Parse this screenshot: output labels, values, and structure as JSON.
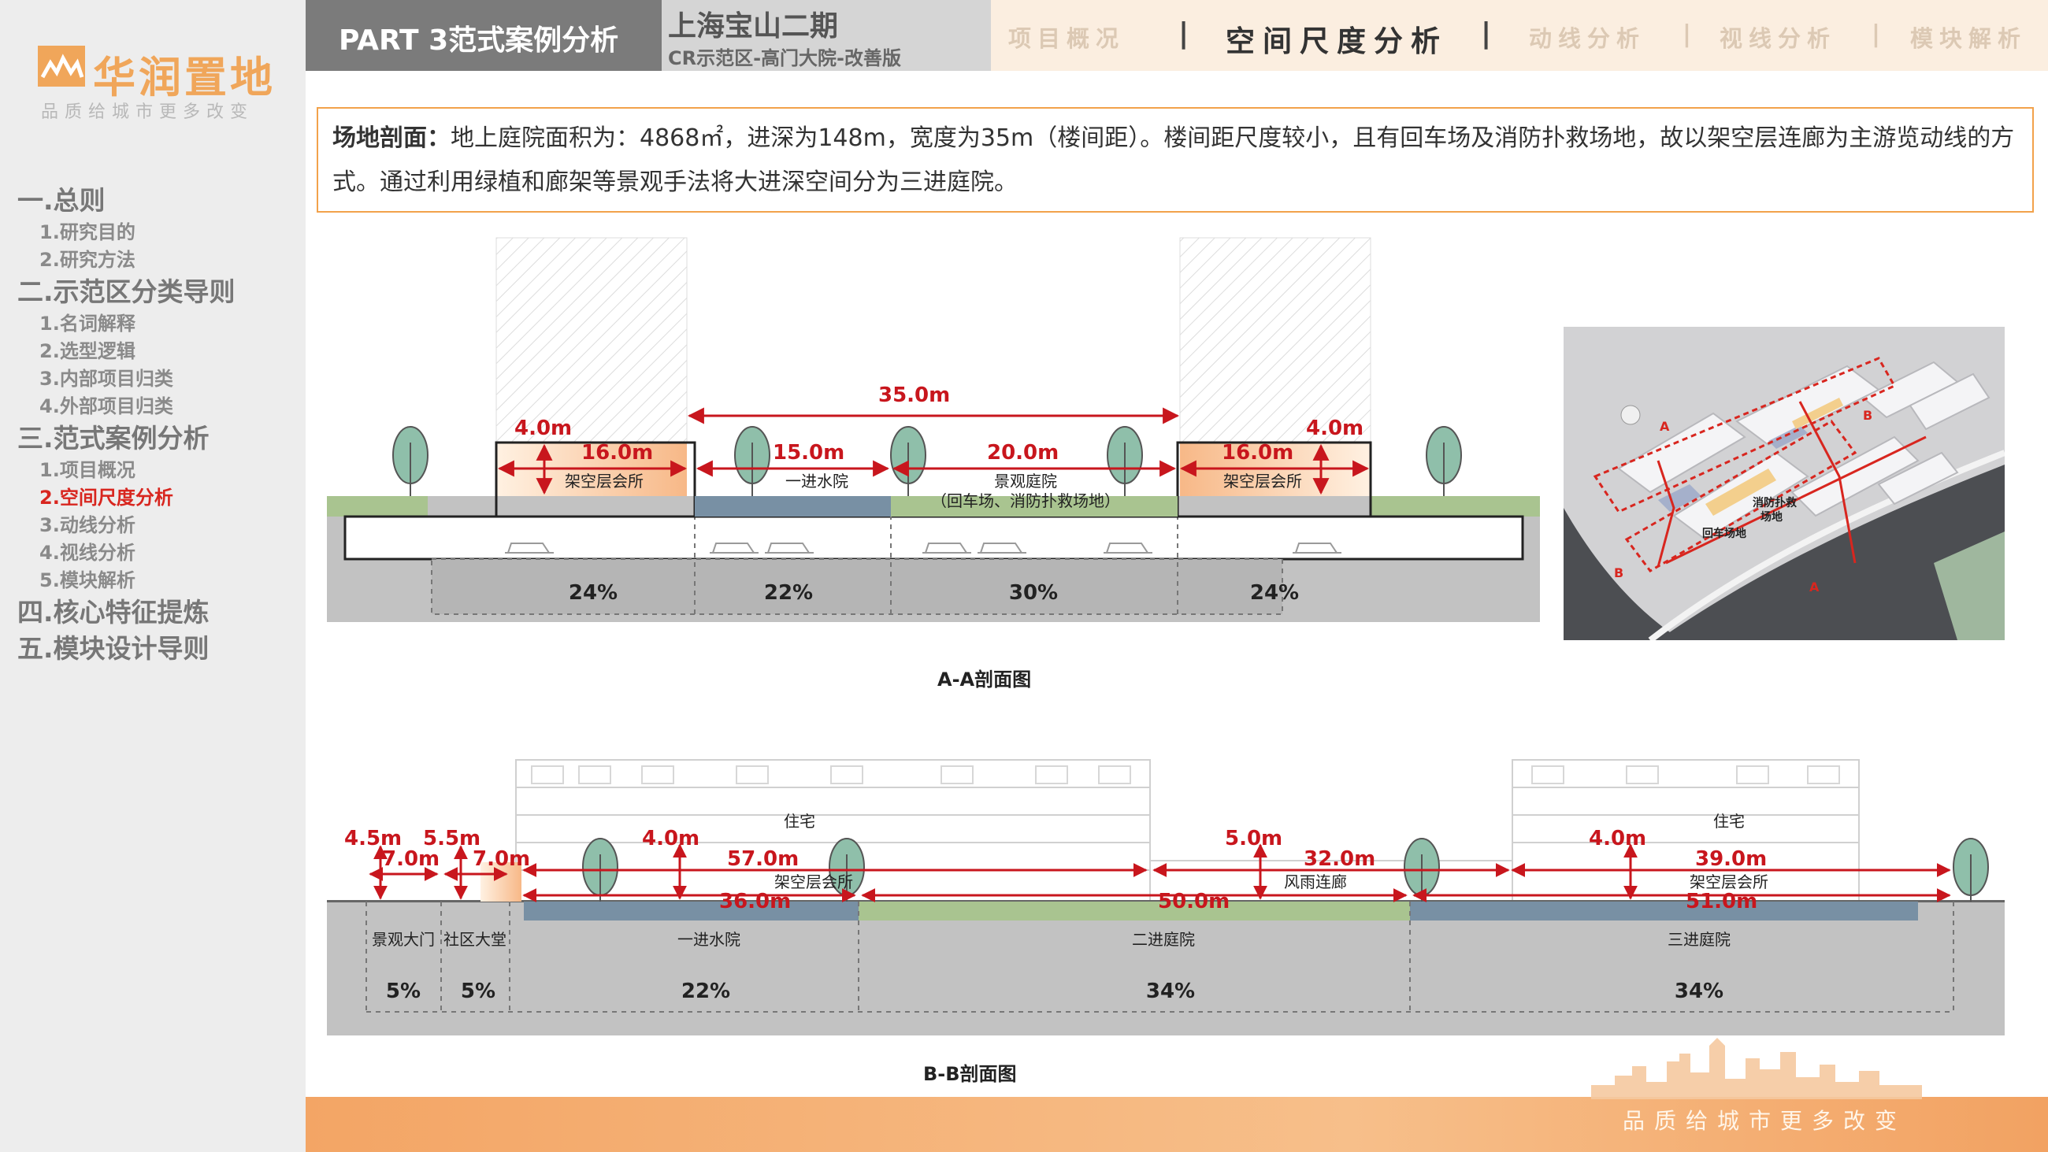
{
  "brand": {
    "name": "华润置地",
    "slogan": "品质给城市更多改变",
    "accent": "#f0a65a"
  },
  "sidebar": {
    "sections": [
      {
        "title": "一.总则",
        "items": [
          "1.研究目的",
          "2.研究方法"
        ]
      },
      {
        "title": "二.示范区分类导则",
        "items": [
          "1.名词解释",
          "2.选型逻辑",
          "3.内部项目归类",
          "4.外部项目归类"
        ]
      },
      {
        "title": "三.范式案例分析",
        "items": [
          "1.项目概况",
          "2.空间尺度分析",
          "3.动线分析",
          "4.视线分析",
          "5.模块解析"
        ]
      },
      {
        "title": "四.核心特征提炼",
        "items": []
      },
      {
        "title": "五.模块设计导则",
        "items": []
      }
    ],
    "active_item": "2.空间尺度分析"
  },
  "header": {
    "part": "PART 3范式案例分析",
    "project_name": "上海宝山二期",
    "project_sub": "CR示范区-高门大院-改善版",
    "tabs": [
      "项目概况",
      "空间尺度分析",
      "动线分析",
      "视线分析",
      "模块解析"
    ],
    "active_tab": "空间尺度分析"
  },
  "description": {
    "label": "场地剖面：",
    "text": "地上庭院面积为：4868㎡，进深为148m，宽度为35m（楼间距）。楼间距尺度较小，且有回车场及消防扑救场地，故以架空层连廊为主游览动线的方式。通过利用绿植和廊架等景观手法将大进深空间分为三进庭院。"
  },
  "section_a": {
    "caption": "A-A剖面图",
    "total": "35.0m",
    "height_left": "4.0m",
    "height_right": "4.0m",
    "dims": [
      "16.0m",
      "15.0m",
      "20.0m",
      "16.0m"
    ],
    "zones": [
      "架空层会所",
      "一进水院",
      "景观庭院",
      "架空层会所"
    ],
    "zone_note": "（回车场、消防扑救场地）",
    "percents": [
      "24%",
      "22%",
      "30%",
      "24%"
    ]
  },
  "map": {
    "labels": {
      "a1": "A",
      "a2": "A",
      "b1": "B",
      "b2": "B",
      "fire": "消防扑救",
      "fire2": "场地",
      "turn": "回车场地"
    }
  },
  "section_b": {
    "caption": "B-B剖面图",
    "building_labels": [
      "住宅",
      "住宅"
    ],
    "heights": [
      "4.5m",
      "5.5m",
      "4.0m",
      "5.0m",
      "4.0m"
    ],
    "gate_dims": [
      "7.0m",
      "7.0m"
    ],
    "upper_dims": [
      "57.0m",
      "32.0m",
      "39.0m"
    ],
    "lower_dims": [
      "36.0m",
      "50.0m",
      "51.0m"
    ],
    "structures": [
      "架空层会所",
      "风雨连廊",
      "架空层会所"
    ],
    "zones": [
      "景观大门",
      "社区大堂",
      "一进水院",
      "二进庭院",
      "三进庭院"
    ],
    "percents": [
      "5%",
      "5%",
      "22%",
      "34%",
      "34%"
    ]
  },
  "colors": {
    "dimension_red": "#c8161d",
    "water": "#7890a4",
    "lawn": "#a9c490",
    "ground": "#bcbcbc",
    "tree": "#8fbfaa"
  }
}
